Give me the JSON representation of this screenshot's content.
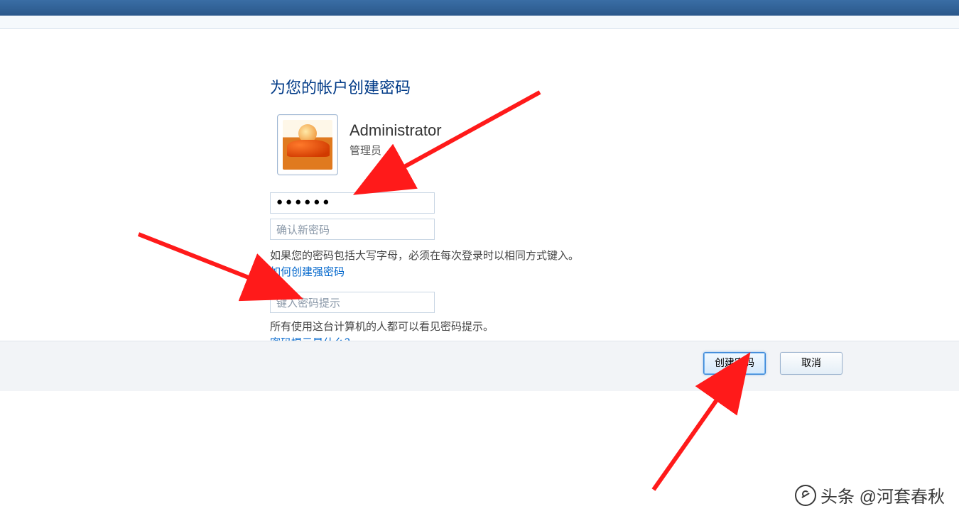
{
  "page": {
    "heading": "为您的帐户创建密码"
  },
  "user": {
    "name": "Administrator",
    "role": "管理员"
  },
  "fields": {
    "password_value": "●●●●●●",
    "confirm_placeholder": "确认新密码",
    "hint_placeholder": "键入密码提示"
  },
  "notes": {
    "caps_warning": "如果您的密码包括大写字母，必须在每次登录时以相同方式键入。",
    "hint_visibility": "所有使用这台计算机的人都可以看见密码提示。"
  },
  "links": {
    "strong_password": "如何创建强密码",
    "what_is_hint": "密码提示是什么？"
  },
  "buttons": {
    "create": "创建密码",
    "cancel": "取消"
  },
  "watermark": {
    "text": "头条 @河套春秋"
  }
}
